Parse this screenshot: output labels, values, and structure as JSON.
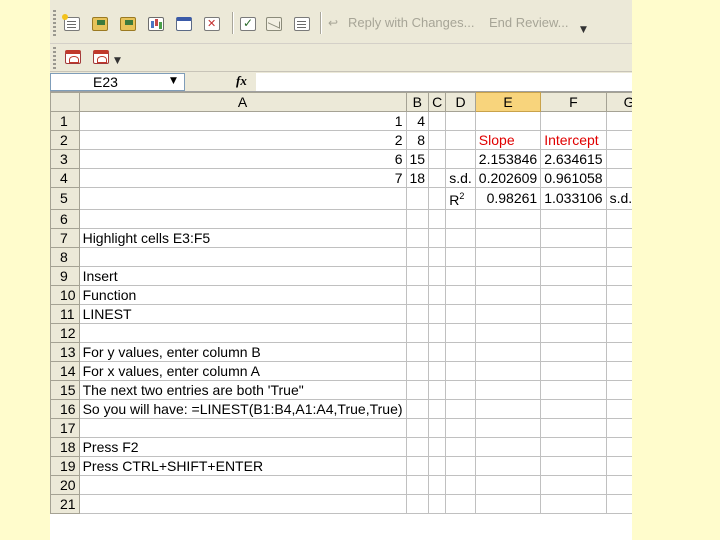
{
  "toolbar": {
    "icons": [
      "new-document-icon",
      "open-folder-icon",
      "save-icon",
      "chart-icon",
      "window-icon",
      "delete-icon",
      "check-icon",
      "envelope-icon"
    ],
    "reply_label": "Reply with Changes...",
    "end_review_label": "End Review...",
    "pdf_icons": [
      "pdf-icon",
      "pdf-options-icon"
    ]
  },
  "formula_bar": {
    "name_box": "E23",
    "fx": "fx",
    "formula": ""
  },
  "columns": [
    "A",
    "B",
    "C",
    "D",
    "E",
    "F",
    "G"
  ],
  "selected_column": "E",
  "rows": [
    {
      "n": "1",
      "A": "1",
      "B": "4"
    },
    {
      "n": "2",
      "E": "Slope",
      "F": "Intercept"
    },
    {
      "n": "3",
      "A": "6",
      "B": "15",
      "E": "2.153846",
      "F": "2.634615"
    },
    {
      "n": "4",
      "A": "7",
      "B": "18",
      "D": "s.d.",
      "E": "0.202609",
      "F": "0.961058"
    },
    {
      "n": "5",
      "D": "R",
      "D_sup": "2",
      "E": "0.98261",
      "F": "1.033106",
      "G": "s.d.(y)"
    },
    {
      "n": "6"
    },
    {
      "n": "7",
      "A": "Highlight cells E3:F5"
    },
    {
      "n": "8"
    },
    {
      "n": "9",
      "A": "Insert"
    },
    {
      "n": "10",
      "A": "Function"
    },
    {
      "n": "11",
      "A": "LINEST"
    },
    {
      "n": "12"
    },
    {
      "n": "13",
      "A": "For y values, enter column B"
    },
    {
      "n": "14",
      "A": "For x values, enter column A"
    },
    {
      "n": "15",
      "A": "The next two entries are both 'True\""
    },
    {
      "n": "16",
      "A": "So you will have: =LINEST(B1:B4,A1:A4,True,True)"
    },
    {
      "n": "17"
    },
    {
      "n": "18",
      "A": "Press F2"
    },
    {
      "n": "19",
      "A": "Press CTRL+SHIFT+ENTER"
    },
    {
      "n": "20"
    },
    {
      "n": "21"
    }
  ],
  "row2_value_B": "8",
  "row2_value_A": "2"
}
